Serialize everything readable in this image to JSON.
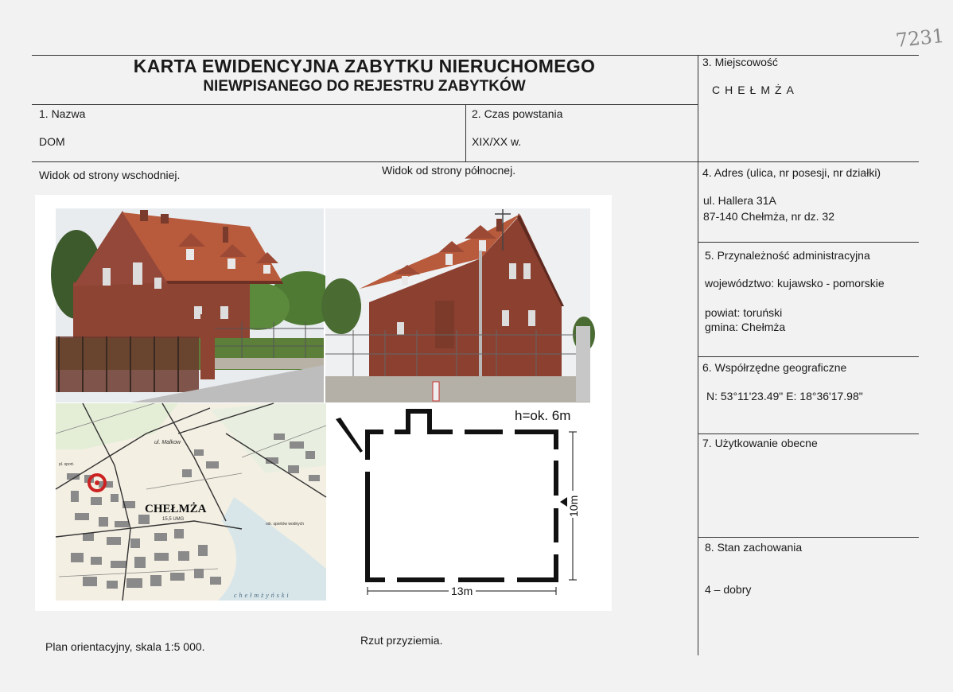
{
  "handwritten_number": "7231",
  "card": {
    "title_line1": "KARTA EWIDENCYJNA ZABYTKU NIERUCHOMEGO",
    "title_line2": "NIEWPISANEGO DO REJESTRU ZABYTKÓW"
  },
  "fields": {
    "name_label": "1. Nazwa",
    "name_value": "DOM",
    "date_label": "2. Czas powstania",
    "date_value": "XIX/XX w.",
    "locality_label": "3. Miejscowość",
    "locality_value": "CHEŁMŻA",
    "address_label": "4. Adres (ulica, nr posesji, nr działki)",
    "address_line1": "ul.  Hallera 31A",
    "address_line2": "87-140 Chełmża, nr dz. 32",
    "admin_label": "5. Przynależność administracyjna",
    "admin_voivodeship": "województwo: kujawsko - pomorskie",
    "admin_county": "powiat: toruński",
    "admin_commune": "gmina: Chełmża",
    "coords_label": "6. Współrzędne geograficzne",
    "coords_value": "N: 53°11'23.49\"   E: 18°36'17.98\"",
    "usage_label": "7. Użytkowanie obecne",
    "usage_value": "",
    "condition_label": "8. Stan zachowania",
    "condition_value": "4 – dobry"
  },
  "captions": {
    "east_view": "Widok od strony wschodniej.",
    "north_view": "Widok od strony północnej.",
    "map_plan": "Plan orientacyjny, skala 1:5 000.",
    "ground_plan": "Rzut przyziemia."
  },
  "map": {
    "town_label": "CHEŁMŻA",
    "elevation_label": "15,5 UMG",
    "street_label": "ul. Malkow",
    "sports_label": "ośr. sportów wodnych",
    "lake_label": "chełmżyński",
    "sport_field_label": "pl. sport."
  },
  "floorplan": {
    "height_label": "h=ok. 6m",
    "width_label": "13m",
    "depth_label": "10m"
  },
  "colors": {
    "brick": "#9a4a36",
    "roof": "#b65a3e",
    "marker": "#cc2222"
  }
}
